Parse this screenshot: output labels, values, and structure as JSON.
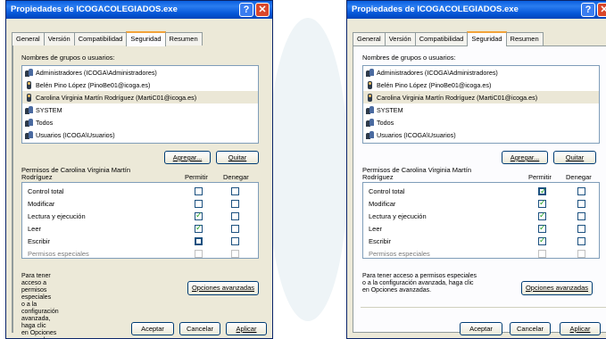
{
  "dialogs": [
    {
      "title": "Propiedades de ICOGACOLEGIADOS.exe",
      "tabs": [
        "General",
        "Versión",
        "Compatibilidad",
        "Seguridad",
        "Resumen"
      ],
      "active_tab": "Seguridad",
      "groups_label": "Nombres de grupos o usuarios:",
      "users": [
        {
          "name": "Administradores (ICOGA\\Administradores)",
          "icon": "group-icon",
          "selected": false
        },
        {
          "name": "Belén Pino López (PinoBe01@icoga.es)",
          "icon": "user-icon",
          "selected": false
        },
        {
          "name": "Carolina Virginia Martín Rodríguez (MartiC01@icoga.es)",
          "icon": "user-icon",
          "selected": true
        },
        {
          "name": "SYSTEM",
          "icon": "group-icon",
          "selected": false
        },
        {
          "name": "Todos",
          "icon": "group-icon",
          "selected": false
        },
        {
          "name": "Usuarios (ICOGA\\Usuarios)",
          "icon": "group-icon",
          "selected": false
        }
      ],
      "add_button": "Agregar...",
      "remove_button": "Quitar",
      "perm_label_1": "Permisos de Carolina Virginia Martín",
      "perm_label_2": "Rodríguez",
      "col_allow": "Permitir",
      "col_deny": "Denegar",
      "permissions": [
        {
          "name": "Control total",
          "allow": false,
          "deny": false
        },
        {
          "name": "Modificar",
          "allow": false,
          "deny": false
        },
        {
          "name": "Lectura y ejecución",
          "allow": true,
          "deny": false
        },
        {
          "name": "Leer",
          "allow": true,
          "deny": false
        },
        {
          "name": "Escribir",
          "allow": false,
          "deny": false
        },
        {
          "name": "Permisos especiales",
          "allow": false,
          "deny": false
        }
      ],
      "advanced_text": [
        "Para tener acceso a permisos especiales",
        "o a la configuración avanzada, haga clic",
        "en Opciones avanzadas."
      ],
      "advanced_button": "Opciones avanzadas",
      "ok_button": "Aceptar",
      "cancel_button": "Cancelar",
      "apply_button": "Aplicar"
    },
    {
      "title": "Propiedades de ICOGACOLEGIADOS.exe",
      "tabs": [
        "General",
        "Versión",
        "Compatibilidad",
        "Seguridad",
        "Resumen"
      ],
      "active_tab": "Seguridad",
      "groups_label": "Nombres de grupos o usuarios:",
      "users": [
        {
          "name": "Administradores (ICOGA\\Administradores)",
          "icon": "group-icon",
          "selected": false
        },
        {
          "name": "Belén Pino López (PinoBe01@icoga.es)",
          "icon": "user-icon",
          "selected": false
        },
        {
          "name": "Carolina Virginia Martín Rodríguez (MartiC01@icoga.es)",
          "icon": "user-icon",
          "selected": true
        },
        {
          "name": "SYSTEM",
          "icon": "group-icon",
          "selected": false
        },
        {
          "name": "Todos",
          "icon": "group-icon",
          "selected": false
        },
        {
          "name": "Usuarios (ICOGA\\Usuarios)",
          "icon": "group-icon",
          "selected": false
        }
      ],
      "add_button": "Agregar...",
      "remove_button": "Quitar",
      "perm_label_1": "Permisos de Carolina Virginia Martín",
      "perm_label_2": "Rodríguez",
      "col_allow": "Permitir",
      "col_deny": "Denegar",
      "permissions": [
        {
          "name": "Control total",
          "allow": true,
          "deny": false
        },
        {
          "name": "Modificar",
          "allow": true,
          "deny": false
        },
        {
          "name": "Lectura y ejecución",
          "allow": true,
          "deny": false
        },
        {
          "name": "Leer",
          "allow": true,
          "deny": false
        },
        {
          "name": "Escribir",
          "allow": true,
          "deny": false
        },
        {
          "name": "Permisos especiales",
          "allow": false,
          "deny": false
        }
      ],
      "advanced_text": [
        "Para tener acceso a permisos especiales",
        "o a la configuración avanzada, haga clic",
        "en Opciones avanzadas."
      ],
      "advanced_button": "Opciones avanzadas",
      "ok_button": "Aceptar",
      "cancel_button": "Cancelar",
      "apply_button": "Aplicar"
    }
  ],
  "colors": {
    "titlebar": "#0a5fe0",
    "dialog_bg": "#ece9d8",
    "selection": "#ebe7d6",
    "check": "#21a121"
  }
}
